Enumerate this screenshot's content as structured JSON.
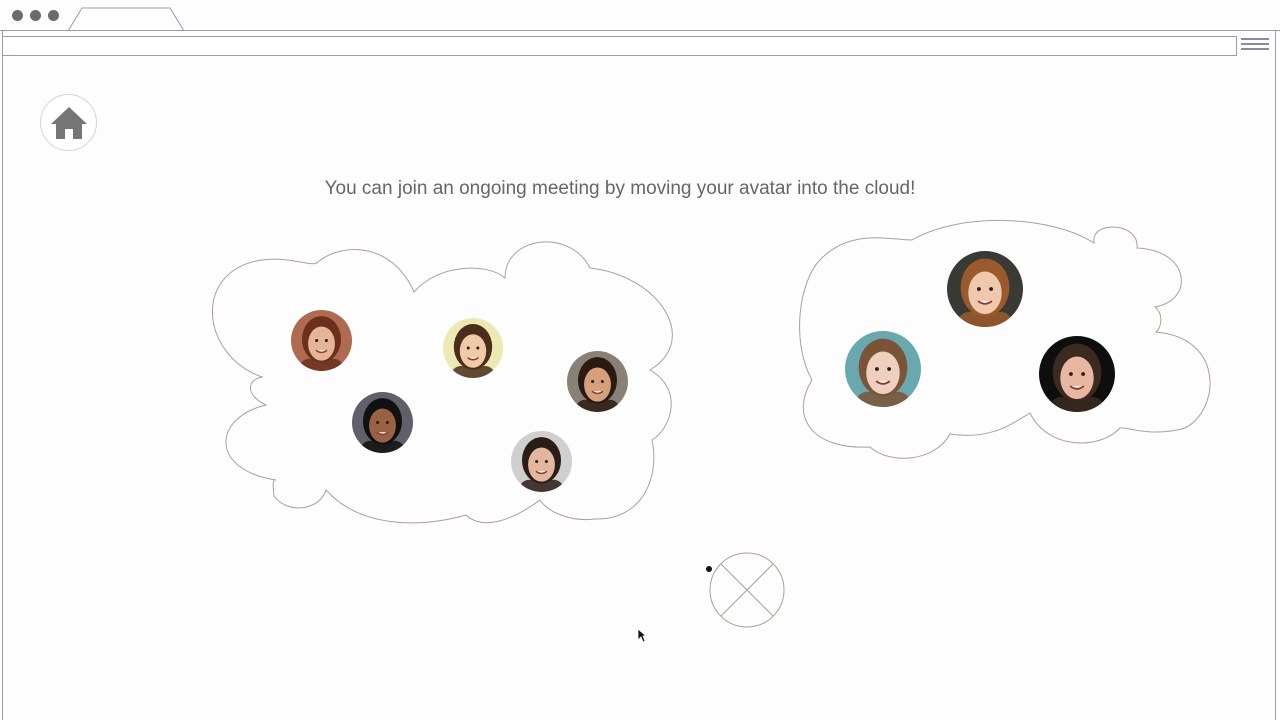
{
  "browser": {
    "traffic_lights": [
      "close",
      "minimize",
      "maximize"
    ],
    "tab_label": "",
    "address": ""
  },
  "home": {
    "icon": "home-icon"
  },
  "instruction": "You can join an ongoing meeting by moving your avatar into the cloud!",
  "clouds": [
    {
      "name": "meeting-cloud-left",
      "participants": [
        {
          "name": "participant-1",
          "skin": "#e6b497",
          "hair": "#6b2f1c",
          "bg": "#b06a52"
        },
        {
          "name": "participant-2",
          "skin": "#f0c9a6",
          "hair": "#4a2e1b",
          "bg": "#ece9b5"
        },
        {
          "name": "participant-3",
          "skin": "#d6a07d",
          "hair": "#2a1a12",
          "bg": "#8a8176"
        },
        {
          "name": "participant-4",
          "skin": "#9a6245",
          "hair": "#111111",
          "bg": "#60606a"
        },
        {
          "name": "participant-5",
          "skin": "#e3b79e",
          "hair": "#2a1c17",
          "bg": "#cfcfcf"
        }
      ]
    },
    {
      "name": "meeting-cloud-right",
      "participants": [
        {
          "name": "participant-6",
          "skin": "#f0c8ad",
          "hair": "#9b5a2c",
          "bg": "#3a3a34"
        },
        {
          "name": "participant-7",
          "skin": "#efd0be",
          "hair": "#7a5436",
          "bg": "#6aa8b0"
        },
        {
          "name": "participant-8",
          "skin": "#e8b6a1",
          "hair": "#3a2a20",
          "bg": "#0e0e0e"
        }
      ]
    }
  ],
  "my_avatar": {
    "state": "empty",
    "icon": "close-x-icon"
  },
  "colors": {
    "cloud_stroke": "#a9a294",
    "text": "#666666",
    "chrome": "#9a9ab0"
  }
}
